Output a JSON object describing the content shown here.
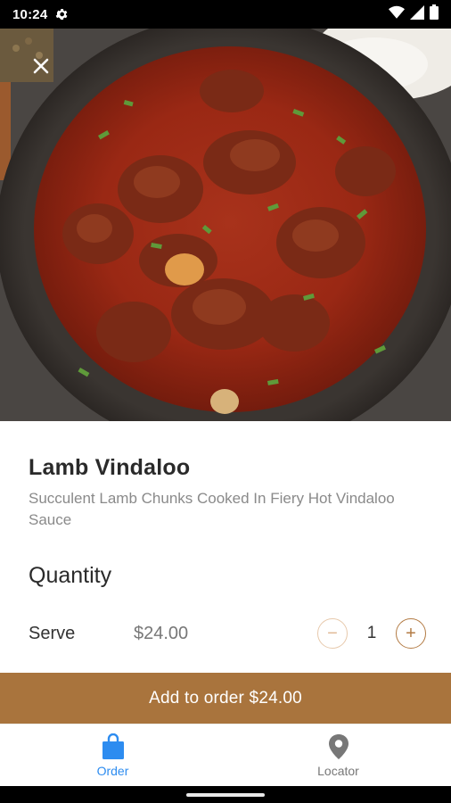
{
  "status_bar": {
    "time": "10:24"
  },
  "item": {
    "title": "Lamb Vindaloo",
    "description": "Succulent Lamb Chunks Cooked In Fiery Hot Vindaloo Sauce"
  },
  "quantity": {
    "heading": "Quantity",
    "serve_label": "Serve",
    "price": "$24.00",
    "count": "1",
    "minus_symbol": "−",
    "plus_symbol": "+"
  },
  "cta": {
    "label": "Add to order $24.00"
  },
  "bottom_nav": {
    "items": [
      {
        "label": "Order",
        "icon": "shopping-bag-icon",
        "active": true
      },
      {
        "label": "Locator",
        "icon": "location-pin-icon",
        "active": false
      }
    ]
  },
  "colors": {
    "accent": "#a9743d",
    "nav_active": "#2d8cf0"
  }
}
